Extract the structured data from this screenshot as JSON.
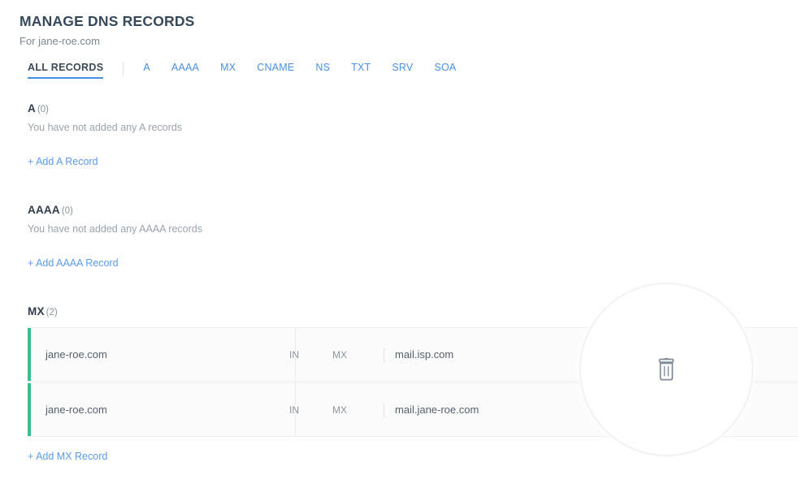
{
  "header": {
    "title": "MANAGE DNS RECORDS",
    "subtitle": "For jane-roe.com"
  },
  "tabs": [
    {
      "label": "ALL RECORDS",
      "active": true
    },
    {
      "label": "A",
      "active": false
    },
    {
      "label": "AAAA",
      "active": false
    },
    {
      "label": "MX",
      "active": false
    },
    {
      "label": "CNAME",
      "active": false
    },
    {
      "label": "NS",
      "active": false
    },
    {
      "label": "TXT",
      "active": false
    },
    {
      "label": "SRV",
      "active": false
    },
    {
      "label": "SOA",
      "active": false
    }
  ],
  "sections": {
    "a": {
      "type": "A",
      "count": "(0)",
      "empty_text": "You have not added any A records",
      "add_label": "+ Add A Record"
    },
    "aaaa": {
      "type": "AAAA",
      "count": "(0)",
      "empty_text": "You have not added any AAAA records",
      "add_label": "+ Add AAAA Record"
    },
    "mx": {
      "type": "MX",
      "count": "(2)",
      "add_label": "+ Add MX Record",
      "rows": [
        {
          "name": "jane-roe.com",
          "class": "IN",
          "rtype": "MX",
          "value": "mail.isp.com"
        },
        {
          "name": "jane-roe.com",
          "class": "IN",
          "rtype": "MX",
          "value": "mail.jane-roe.com"
        }
      ]
    }
  },
  "overlay": {
    "icon": "trash-icon",
    "icon_color": "#7f8b9a"
  },
  "colors": {
    "accent_blue": "#4a90e2",
    "link_blue": "#5b9bf0",
    "row_accent_green": "#3cbd8e",
    "title": "#36495b"
  }
}
